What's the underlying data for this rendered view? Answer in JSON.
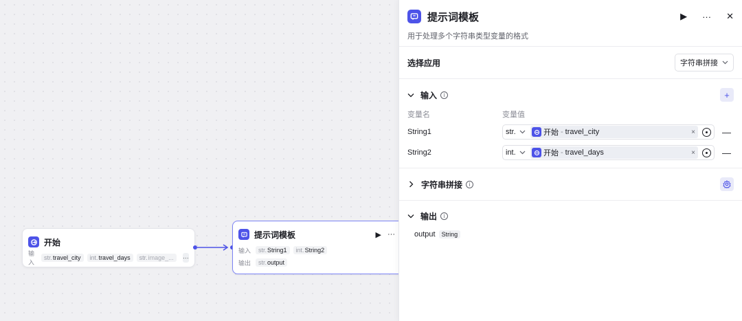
{
  "canvas": {
    "start_node": {
      "title": "开始",
      "input_label": "输入",
      "inputs": [
        {
          "type": "str.",
          "name": "travel_city"
        },
        {
          "type": "int.",
          "name": "travel_days"
        },
        {
          "type": "str.",
          "name": "image_..."
        }
      ],
      "more": "···"
    },
    "prompt_node": {
      "title": "提示词模板",
      "run": "▶",
      "more": "···",
      "input_label": "输入",
      "inputs": [
        {
          "type": "str.",
          "name": "String1"
        },
        {
          "type": "int.",
          "name": "String2"
        }
      ],
      "output_label": "输出",
      "outputs": [
        {
          "type": "str.",
          "name": "output"
        }
      ]
    }
  },
  "panel": {
    "title": "提示词模板",
    "description": "用于处理多个字符串类型变量的格式",
    "run": "▶",
    "more": "···",
    "close": "✕",
    "app_section": {
      "label": "选择应用",
      "selected": "字符串拼接"
    },
    "input_section": {
      "label": "输入",
      "add": "+",
      "col_name": "变量名",
      "col_value": "变量值",
      "rows": [
        {
          "name": "String1",
          "type": "str.",
          "source": "开始",
          "sep": "-",
          "var": "travel_city",
          "remove": "×",
          "minus": "—"
        },
        {
          "name": "String2",
          "type": "int.",
          "source": "开始",
          "sep": "-",
          "var": "travel_days",
          "remove": "×",
          "minus": "—"
        }
      ]
    },
    "concat_section": {
      "label": "字符串拼接"
    },
    "output_section": {
      "label": "输出",
      "name": "output",
      "type": "String"
    }
  },
  "colors": {
    "accent": "#4d53e8",
    "selected_border": "#7c84f5",
    "canvas_bg": "#f0f0f3"
  }
}
